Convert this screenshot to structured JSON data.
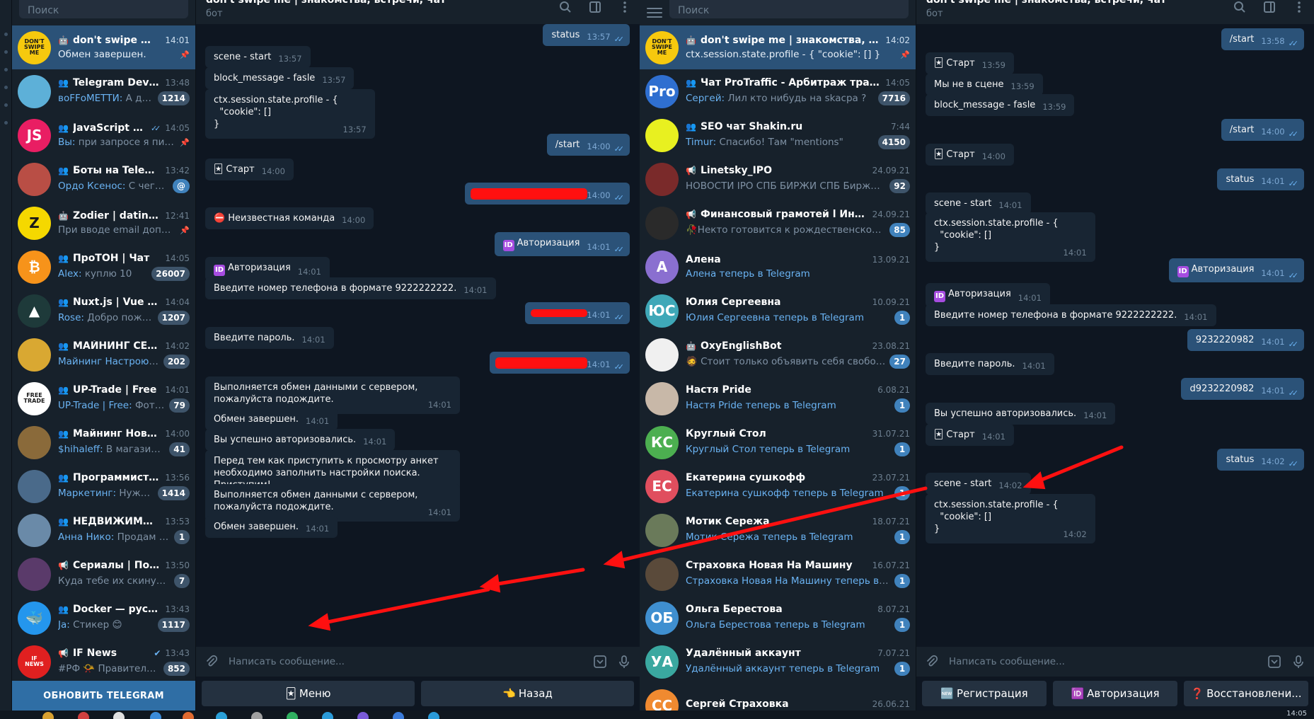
{
  "left": {
    "search_placeholder": "Поиск",
    "update_button": "ОБНОВИТЬ TELEGRAM",
    "chats": [
      {
        "name": "don't swipe me | ...",
        "time": "14:01",
        "preview": "Обмен завершен.",
        "sender": "",
        "type": "bot",
        "pinned": true,
        "active": true,
        "avatar_text": "DON'T SWIPE ME",
        "avatar_color": "#f6c90e"
      },
      {
        "name": "Telegram Develop...",
        "time": "13:48",
        "preview": "А для отц...",
        "sender": "воFFоМЕТТИ:",
        "type": "group",
        "badge": "1214",
        "avatar_text": "",
        "avatar_color": "#5db0d8"
      },
      {
        "name": "JavaScript Noo...",
        "time": "14:05",
        "preview": "при запросе я пиш...",
        "sender": "Вы:",
        "type": "group",
        "pinned": true,
        "sent": true,
        "avatar_text": "JS",
        "avatar_color": "#e91e63"
      },
      {
        "name": "Боты на Telegraf ...",
        "time": "13:42",
        "preview": "С чего ты в...",
        "sender": "Ордо Ксенос:",
        "type": "group",
        "mention": true,
        "avatar_text": "",
        "avatar_color": "#b94e45"
      },
      {
        "name": "Zodier | dating, m...",
        "time": "12:41",
        "preview": "При вводе email допущ...",
        "sender": "",
        "type": "bot",
        "pinned": true,
        "avatar_text": "Z",
        "avatar_color": "#f5d800"
      },
      {
        "name": "ПроТОН | Чат",
        "time": "14:05",
        "preview": "куплю 10",
        "sender": "Alex:",
        "type": "group",
        "badge": "26007",
        "avatar_text": "₿",
        "avatar_color": "#f7931a"
      },
      {
        "name": "Nuxt.js | Vue SSR",
        "time": "14:04",
        "preview": "Добро пожало...",
        "sender": "Rose:",
        "type": "group",
        "badge": "1207",
        "avatar_text": "▲",
        "avatar_color": "#1e3a3a"
      },
      {
        "name": "МАЙНИНГ СЕКТА...",
        "time": "14:02",
        "preview": "Н...",
        "sender": "Майнинг Настрою:",
        "type": "group",
        "badge": "202",
        "avatar_text": "",
        "avatar_color": "#d9a832"
      },
      {
        "name": "UP-Trade | Free",
        "time": "14:01",
        "preview": "Фотог...",
        "sender": "UP-Trade | Free:",
        "type": "group",
        "badge": "79",
        "avatar_text": "FREE TRADE",
        "avatar_color": "#ffffff"
      },
      {
        "name": "Майнинг Новоси...",
        "time": "14:00",
        "preview": "В магазинчик...",
        "sender": "$hihaleff:",
        "type": "group",
        "badge": "41",
        "avatar_text": "",
        "avatar_color": "#8a6a3a"
      },
      {
        "name": "Программисты. ...",
        "time": "13:56",
        "preview": "Нужно д...",
        "sender": "Маркетинг:",
        "type": "group",
        "badge": "1414",
        "avatar_text": "",
        "avatar_color": "#4a6a8a"
      },
      {
        "name": "НЕДВИЖИМОСТЬ...",
        "time": "13:53",
        "preview": "Продам до...",
        "sender": "Анна Нико:",
        "type": "group",
        "badge": "1",
        "avatar_text": "",
        "avatar_color": "#6a8aa8"
      },
      {
        "name": "Сериалы | Поло...",
        "time": "13:50",
        "preview": "Куда тебе их скинуть?",
        "sender": "",
        "type": "channel",
        "badge": "7",
        "avatar_text": "",
        "avatar_color": "#5a3a6a"
      },
      {
        "name": "Docker — русског...",
        "time": "13:43",
        "preview": "Стикер 😊",
        "sender": "Ja:",
        "type": "group",
        "badge": "1117",
        "avatar_text": "🐳",
        "avatar_color": "#2496ed"
      },
      {
        "name": "IF News",
        "time": "13:43",
        "preview": "#РФ 📯 Правительст...",
        "sender": "",
        "type": "channel",
        "verified": true,
        "badge": "852",
        "avatar_text": "IF NEWS",
        "avatar_color": "#e02020"
      }
    ],
    "conv": {
      "title": "don't swipe me | знакомства, встречи, чат",
      "subtitle": "бот",
      "composer_placeholder": "Написать сообщение...",
      "keyboard": [
        {
          "icon": "🃏",
          "label": "Меню"
        },
        {
          "icon": "👈",
          "label": "Назад"
        }
      ],
      "messages": [
        {
          "dir": "out",
          "text": "status",
          "time": "13:57"
        },
        {
          "dir": "in",
          "text": "scene - start",
          "time": "13:57"
        },
        {
          "dir": "in",
          "text": "block_message - fasle",
          "time": "13:57"
        },
        {
          "dir": "in",
          "text": "ctx.session.state.profile - {\n  \"cookie\": []\n}",
          "time": "13:57"
        },
        {
          "dir": "out",
          "text": "/start",
          "time": "14:00"
        },
        {
          "dir": "in",
          "icon": "🃏",
          "text": "Старт",
          "time": "14:00"
        },
        {
          "dir": "out",
          "text": "",
          "time": "14:00",
          "redacted": true
        },
        {
          "dir": "in",
          "icon": "⛔",
          "text": "Неизвестная команда",
          "time": "14:00"
        },
        {
          "dir": "out",
          "id_icon": true,
          "text": "Авторизация",
          "time": "14:01"
        },
        {
          "dir": "in",
          "id_icon": true,
          "text": "Авторизация",
          "time": "14:01"
        },
        {
          "dir": "in",
          "text": "Введите номер телефона в формате 9222222222.",
          "time": "14:01"
        },
        {
          "dir": "out",
          "text": "",
          "time": "14:01",
          "redacted": true
        },
        {
          "dir": "in",
          "text": "Введите пароль.",
          "time": "14:01"
        },
        {
          "dir": "out",
          "text": "",
          "time": "14:01",
          "redacted": true
        },
        {
          "dir": "in",
          "text": "Выполняется обмен данными с сервером, пожалуйста подождите.",
          "time": "14:01"
        },
        {
          "dir": "in",
          "text": "Обмен завершен.",
          "time": "14:01"
        },
        {
          "dir": "in",
          "text": "Вы успешно авторизовались.",
          "time": "14:01"
        },
        {
          "dir": "in",
          "text": "Перед тем как приступить к просмотру анкет необходимо заполнить настройки поиска. Приступим!",
          "time": "14:01"
        },
        {
          "dir": "in",
          "text": "Выполняется обмен данными с сервером, пожалуйста подождите.",
          "time": "14:01"
        },
        {
          "dir": "in",
          "text": "Обмен завершен.",
          "time": "14:01"
        }
      ]
    }
  },
  "right": {
    "search_placeholder": "Поиск",
    "chats": [
      {
        "name": "don't swipe me | знакомства, встречи...",
        "time": "14:02",
        "preview": "ctx.session.state.profile - {   \"cookie\": [] }",
        "sender": "",
        "type": "bot",
        "pinned": true,
        "active": true,
        "avatar_text": "DON'T SWIPE ME",
        "avatar_color": "#f6c90e"
      },
      {
        "name": "Чат ProTraffic - Арбитраж трафика",
        "time": "14:05",
        "preview": "Лил кто нибудь на skacpa ?",
        "sender": "Сергей:",
        "type": "group",
        "badge": "7716",
        "avatar_text": "Pro",
        "avatar_color": "#2f6fd0"
      },
      {
        "name": "SEO чат Shakin.ru",
        "time": "7:44",
        "preview": "Спасибо! Там \"mentions\"",
        "sender": "Timur:",
        "type": "group",
        "badge": "4150",
        "avatar_text": "",
        "avatar_color": "#e8f020"
      },
      {
        "name": "Linetsky_IPO",
        "time": "24.09.21",
        "preview": "НОВОСТИ IPO СПБ БИРЖИ  СПБ Биржа мож...",
        "sender": "",
        "type": "channel",
        "badge": "92",
        "avatar_text": "",
        "avatar_color": "#7a2a2a"
      },
      {
        "name": "Финансовый грамотей l Инвести...",
        "time": "24.09.21",
        "preview": "🥀Некто готовится к рождественскому  ра...",
        "sender": "",
        "type": "channel",
        "badge": "85",
        "badge_blue": true,
        "avatar_text": "",
        "avatar_color": "#2a2a2a"
      },
      {
        "name": "Алена",
        "time": "13.09.21",
        "preview": "Алена теперь в Telegram",
        "sender": "",
        "type": "user",
        "preview_blue": true,
        "avatar_text": "А",
        "avatar_color": "#8a6fd0"
      },
      {
        "name": "Юлия Сергеевна",
        "time": "10.09.21",
        "preview": "Юлия Сергеевна теперь в Telegram",
        "sender": "",
        "type": "user",
        "preview_blue": true,
        "badge": "1",
        "badge_blue": true,
        "avatar_text": "ЮС",
        "avatar_color": "#3fa8b8"
      },
      {
        "name": "OxyEnglishBot",
        "time": "23.08.21",
        "preview": "🧔 Стоит только объявить себя свободны...",
        "sender": "",
        "type": "bot",
        "badge": "27",
        "badge_blue": true,
        "avatar_text": "",
        "avatar_color": "#f0f0f0"
      },
      {
        "name": "Настя Pride",
        "time": "6.08.21",
        "preview": "Настя Pride теперь в Telegram",
        "sender": "",
        "type": "user",
        "preview_blue": true,
        "badge": "1",
        "badge_blue": true,
        "avatar_text": "",
        "avatar_color": "#c8b8a8"
      },
      {
        "name": "Круглый Стол",
        "time": "31.07.21",
        "preview": "Круглый Стол теперь в Telegram",
        "sender": "",
        "type": "user",
        "preview_blue": true,
        "badge": "1",
        "badge_blue": true,
        "avatar_text": "КС",
        "avatar_color": "#4caf50"
      },
      {
        "name": "Екатерина сушкофф",
        "time": "23.07.21",
        "preview": "Екатерина сушкофф теперь в Telegram",
        "sender": "",
        "type": "user",
        "preview_blue": true,
        "badge": "1",
        "badge_blue": true,
        "avatar_text": "ЕС",
        "avatar_color": "#e04e5e"
      },
      {
        "name": "Мотик Сережа",
        "time": "18.07.21",
        "preview": "Мотик Сережа теперь в Telegram",
        "sender": "",
        "type": "user",
        "preview_blue": true,
        "badge": "1",
        "badge_blue": true,
        "avatar_text": "",
        "avatar_color": "#6a7a5a"
      },
      {
        "name": "Страховка Новая На Машину",
        "time": "16.07.21",
        "preview": "Страховка Новая На Машину теперь в Teleg...",
        "sender": "",
        "type": "user",
        "preview_blue": true,
        "badge": "1",
        "badge_blue": true,
        "avatar_text": "",
        "avatar_color": "#5a4a3a"
      },
      {
        "name": "Ольга Берестова",
        "time": "8.07.21",
        "preview": "Ольга Берестова теперь в Telegram",
        "sender": "",
        "type": "user",
        "preview_blue": true,
        "badge": "1",
        "badge_blue": true,
        "avatar_text": "ОБ",
        "avatar_color": "#3f8fd0"
      },
      {
        "name": "Удалённый аккаунт",
        "time": "7.07.21",
        "preview": "Удалённый аккаунт теперь в Telegram",
        "sender": "",
        "type": "user",
        "preview_blue": true,
        "badge": "1",
        "badge_blue": true,
        "avatar_text": "УА",
        "avatar_color": "#3aa8a0"
      },
      {
        "name": "Сергей Страховка",
        "time": "26.06.21",
        "preview": "",
        "sender": "",
        "type": "user",
        "avatar_text": "СС",
        "avatar_color": "#f08a30"
      }
    ],
    "conv": {
      "title": "don't swipe me | знакомства, встречи, чат",
      "subtitle": "бот",
      "composer_placeholder": "Написать сообщение...",
      "keyboard": [
        {
          "icon": "🆕",
          "label": "Регистрация"
        },
        {
          "icon": "🆔",
          "label": "Авторизация"
        },
        {
          "icon": "❓",
          "label": "Восстановлени..."
        }
      ],
      "messages": [
        {
          "dir": "out",
          "text": "/start",
          "time": "13:58"
        },
        {
          "dir": "in",
          "icon": "🃏",
          "text": "Старт",
          "time": "13:59"
        },
        {
          "dir": "in",
          "text": "Мы не в сцене",
          "time": "13:59"
        },
        {
          "dir": "in",
          "text": "block_message - fasle",
          "time": "13:59"
        },
        {
          "dir": "out",
          "text": "/start",
          "time": "14:00"
        },
        {
          "dir": "in",
          "icon": "🃏",
          "text": "Старт",
          "time": "14:00"
        },
        {
          "dir": "out",
          "text": "status",
          "time": "14:01"
        },
        {
          "dir": "in",
          "text": "scene - start",
          "time": "14:01"
        },
        {
          "dir": "in",
          "text": "ctx.session.state.profile - {\n  \"cookie\": []\n}",
          "time": "14:01"
        },
        {
          "dir": "out",
          "id_icon": true,
          "text": "Авторизация",
          "time": "14:01"
        },
        {
          "dir": "in",
          "id_icon": true,
          "text": "Авторизация",
          "time": "14:01"
        },
        {
          "dir": "in",
          "text": "Введите номер телефона в формате 9222222222.",
          "time": "14:01"
        },
        {
          "dir": "out",
          "text": "9232220982",
          "time": "14:01"
        },
        {
          "dir": "in",
          "text": "Введите пароль.",
          "time": "14:01"
        },
        {
          "dir": "out",
          "text": "d9232220982",
          "time": "14:01"
        },
        {
          "dir": "in",
          "text": "Вы успешно авторизовались.",
          "time": "14:01"
        },
        {
          "dir": "in",
          "icon": "🃏",
          "text": "Старт",
          "time": "14:01"
        },
        {
          "dir": "out",
          "text": "status",
          "time": "14:02"
        },
        {
          "dir": "in",
          "text": "scene - start",
          "time": "14:02"
        },
        {
          "dir": "in",
          "text": "ctx.session.state.profile - {\n  \"cookie\": []\n}",
          "time": "14:02"
        }
      ]
    }
  },
  "taskbar": {
    "clock": "14:05"
  },
  "colors": {
    "accent": "#2b5278",
    "annotation_red": "#ff1010",
    "bg": "#0e1621",
    "panel": "#17212b"
  }
}
